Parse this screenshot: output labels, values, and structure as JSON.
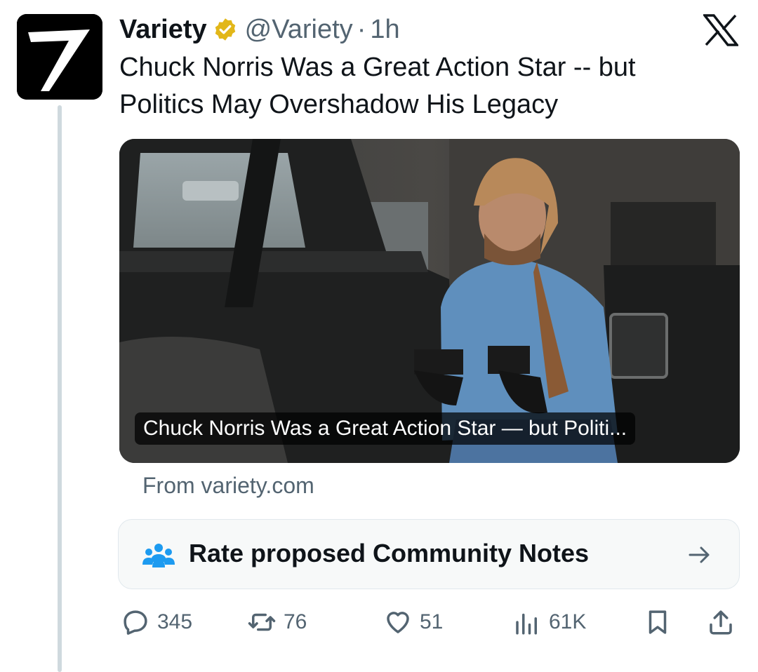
{
  "tweet": {
    "display_name": "Variety",
    "handle": "@Variety",
    "separator": "·",
    "time": "1h",
    "text": "Chuck Norris Was a Great Action Star -- but Politics May Overshadow His Legacy"
  },
  "card": {
    "title": "Chuck Norris Was a Great Action Star — but Politi...",
    "source": "From variety.com"
  },
  "community_notes": {
    "label": "Rate proposed Community Notes"
  },
  "actions": {
    "replies": "345",
    "reposts": "76",
    "likes": "51",
    "views": "61K"
  },
  "icons": {
    "avatar": "variety-v-logo",
    "verified": "verified-badge-icon",
    "x_logo": "x-logo-icon",
    "community": "people-icon",
    "arrow": "arrow-right-icon",
    "reply": "reply-icon",
    "repost": "repost-icon",
    "like": "heart-icon",
    "views": "views-icon",
    "bookmark": "bookmark-icon",
    "share": "share-icon"
  },
  "colors": {
    "verified_badge": "#e2b719",
    "secondary_text": "#536471",
    "community_icon": "#1d9bf0",
    "thread_line": "#cfd9de"
  }
}
